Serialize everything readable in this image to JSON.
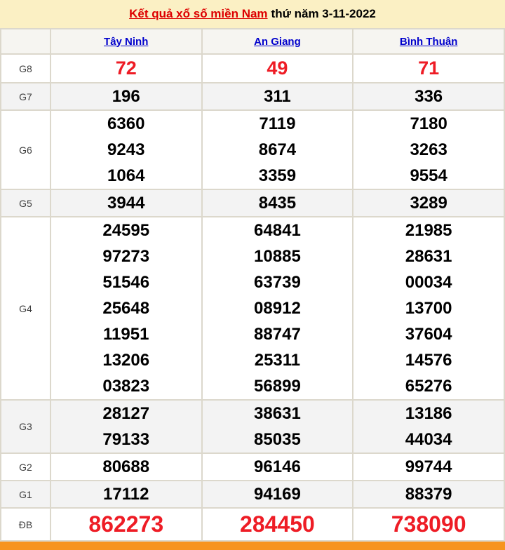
{
  "title": {
    "link": "Kết quả xổ số miền Nam",
    "suffix": "thứ năm 3-11-2022"
  },
  "columns": [
    "Tây Ninh",
    "An Giang",
    "Bình Thuận"
  ],
  "prizes": [
    {
      "label": "G8",
      "style": "first",
      "cells": [
        [
          "72"
        ],
        [
          "49"
        ],
        [
          "71"
        ]
      ]
    },
    {
      "label": "G7",
      "style": "normal",
      "cells": [
        [
          "196"
        ],
        [
          "311"
        ],
        [
          "336"
        ]
      ]
    },
    {
      "label": "G6",
      "style": "normal",
      "cells": [
        [
          "6360",
          "9243",
          "1064"
        ],
        [
          "7119",
          "8674",
          "3359"
        ],
        [
          "7180",
          "3263",
          "9554"
        ]
      ]
    },
    {
      "label": "G5",
      "style": "normal",
      "cells": [
        [
          "3944"
        ],
        [
          "8435"
        ],
        [
          "3289"
        ]
      ]
    },
    {
      "label": "G4",
      "style": "normal",
      "cells": [
        [
          "24595",
          "97273",
          "51546",
          "25648",
          "11951",
          "13206",
          "03823"
        ],
        [
          "64841",
          "10885",
          "63739",
          "08912",
          "88747",
          "25311",
          "56899"
        ],
        [
          "21985",
          "28631",
          "00034",
          "13700",
          "37604",
          "14576",
          "65276"
        ]
      ]
    },
    {
      "label": "G3",
      "style": "normal",
      "cells": [
        [
          "28127",
          "79133"
        ],
        [
          "38631",
          "85035"
        ],
        [
          "13186",
          "44034"
        ]
      ]
    },
    {
      "label": "G2",
      "style": "normal",
      "cells": [
        [
          "80688"
        ],
        [
          "96146"
        ],
        [
          "99744"
        ]
      ]
    },
    {
      "label": "G1",
      "style": "normal",
      "cells": [
        [
          "17112"
        ],
        [
          "94169"
        ],
        [
          "88379"
        ]
      ]
    },
    {
      "label": "ĐB",
      "style": "special",
      "cells": [
        [
          "862273"
        ],
        [
          "284450"
        ],
        [
          "738090"
        ]
      ]
    }
  ],
  "colors": {
    "title_bar_bg": "#fbf0c4",
    "title_link_red": "#dd0000",
    "header_link_blue": "#0000cc",
    "value_red": "#ee1c25",
    "alt_row_bg": "#f3f3f3",
    "footer_orange": "#f7941e"
  }
}
